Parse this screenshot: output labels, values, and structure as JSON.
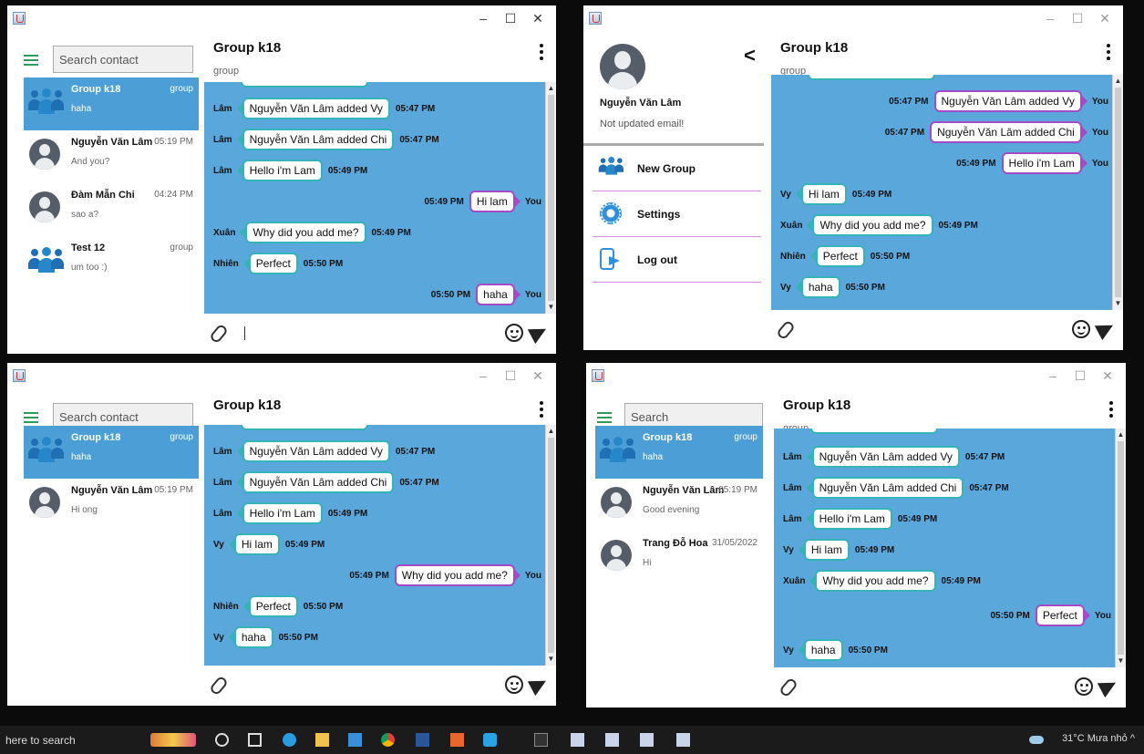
{
  "taskbar": {
    "search_text": "here to search",
    "weather": "31°C  Mưa nhỏ",
    "tray_chevron": "^"
  },
  "window_controls": {
    "min": "–",
    "max": "☐",
    "close": "✕"
  },
  "common": {
    "group_title": "Group k18",
    "group_sub": "group",
    "you": "You"
  },
  "colors": {
    "chat_bg": "#5aa7dc",
    "selected": "#4c9fd6",
    "bubble_in_border": "#36b3b7",
    "bubble_out_border": "#a54ac7"
  },
  "win1": {
    "search_placeholder": "Search contact",
    "contacts": [
      {
        "name": "Group k18",
        "time": "group",
        "msg": "haha",
        "type": "group"
      },
      {
        "name": "Nguyễn Văn Lâm",
        "time": "05:19 PM",
        "msg": "And you?",
        "type": "user"
      },
      {
        "name": "Đàm Mẫn Chi",
        "time": "04:24 PM",
        "msg": "sao a?",
        "type": "user"
      },
      {
        "name": "Test 12",
        "time": "group",
        "msg": "um too :)",
        "type": "group"
      }
    ],
    "messages": [
      {
        "who": "Lâm",
        "text": "Nguyễn Văn Lâm added Vy",
        "time": "05:47 PM"
      },
      {
        "who": "Lâm",
        "text": "Nguyễn Văn Lâm added Chi",
        "time": "05:47 PM"
      },
      {
        "who": "Lâm",
        "text": "Hello i'm Lam",
        "time": "05:49 PM"
      },
      {
        "who": "You",
        "text": "Hi lam",
        "time": "05:49 PM"
      },
      {
        "who": "Xuân",
        "text": "Why did you add me?",
        "time": "05:49 PM"
      },
      {
        "who": "Nhiên",
        "text": "Perfect",
        "time": "05:50 PM"
      },
      {
        "who": "You",
        "text": "haha",
        "time": "05:50 PM"
      }
    ]
  },
  "win2": {
    "menu": {
      "user_name": "Nguyễn Văn Lâm",
      "email": "Not updated email!",
      "back": "<",
      "items": [
        "New Group",
        "Settings",
        "Log out"
      ]
    },
    "messages": [
      {
        "who": "You",
        "text": "Nguyễn Văn Lâm added Vy",
        "time": "05:47 PM"
      },
      {
        "who": "You",
        "text": "Nguyễn Văn Lâm added Chi",
        "time": "05:47 PM"
      },
      {
        "who": "You",
        "text": "Hello i'm Lam",
        "time": "05:49 PM"
      },
      {
        "who": "Vy",
        "text": "Hi lam",
        "time": "05:49 PM"
      },
      {
        "who": "Xuân",
        "text": "Why did you add me?",
        "time": "05:49 PM"
      },
      {
        "who": "Nhiên",
        "text": "Perfect",
        "time": "05:50 PM"
      },
      {
        "who": "Vy",
        "text": "haha",
        "time": "05:50 PM"
      }
    ]
  },
  "win3": {
    "search_placeholder": "Search contact",
    "contacts": [
      {
        "name": "Group k18",
        "time": "group",
        "msg": "haha",
        "type": "group"
      },
      {
        "name": "Nguyễn Văn Lâm",
        "time": "05:19 PM",
        "msg": "Hi ong",
        "type": "user"
      }
    ],
    "messages": [
      {
        "who": "Lâm",
        "text": "Nguyễn Văn Lâm added Vy",
        "time": "05:47 PM"
      },
      {
        "who": "Lâm",
        "text": "Nguyễn Văn Lâm added Chi",
        "time": "05:47 PM"
      },
      {
        "who": "Lâm",
        "text": "Hello i'm Lam",
        "time": "05:49 PM"
      },
      {
        "who": "Vy",
        "text": "Hi lam",
        "time": "05:49 PM"
      },
      {
        "who": "You",
        "text": "Why did you add me?",
        "time": "05:49 PM"
      },
      {
        "who": "Nhiên",
        "text": "Perfect",
        "time": "05:50 PM"
      },
      {
        "who": "Vy",
        "text": "haha",
        "time": "05:50 PM"
      }
    ]
  },
  "win4": {
    "search_placeholder": "Search",
    "contacts": [
      {
        "name": "Group k18",
        "time": "group",
        "msg": "haha",
        "type": "group"
      },
      {
        "name": "Nguyễn Văn Lâm",
        "time": "05:19 PM",
        "msg": "Good evening",
        "type": "user"
      },
      {
        "name": "Trang Đỗ Hoa",
        "time": "31/05/2022",
        "msg": "Hi",
        "type": "user"
      }
    ],
    "messages": [
      {
        "who": "Lâm",
        "text": "Nguyễn Văn Lâm added Vy",
        "time": "05:47 PM"
      },
      {
        "who": "Lâm",
        "text": "Nguyễn Văn Lâm added Chi",
        "time": "05:47 PM"
      },
      {
        "who": "Lâm",
        "text": "Hello i'm Lam",
        "time": "05:49 PM"
      },
      {
        "who": "Vy",
        "text": "Hi lam",
        "time": "05:49 PM"
      },
      {
        "who": "Xuân",
        "text": "Why did you add me?",
        "time": "05:49 PM"
      },
      {
        "who": "You",
        "text": "Perfect",
        "time": "05:50 PM"
      },
      {
        "who": "Vy",
        "text": "haha",
        "time": "05:50 PM"
      }
    ]
  }
}
